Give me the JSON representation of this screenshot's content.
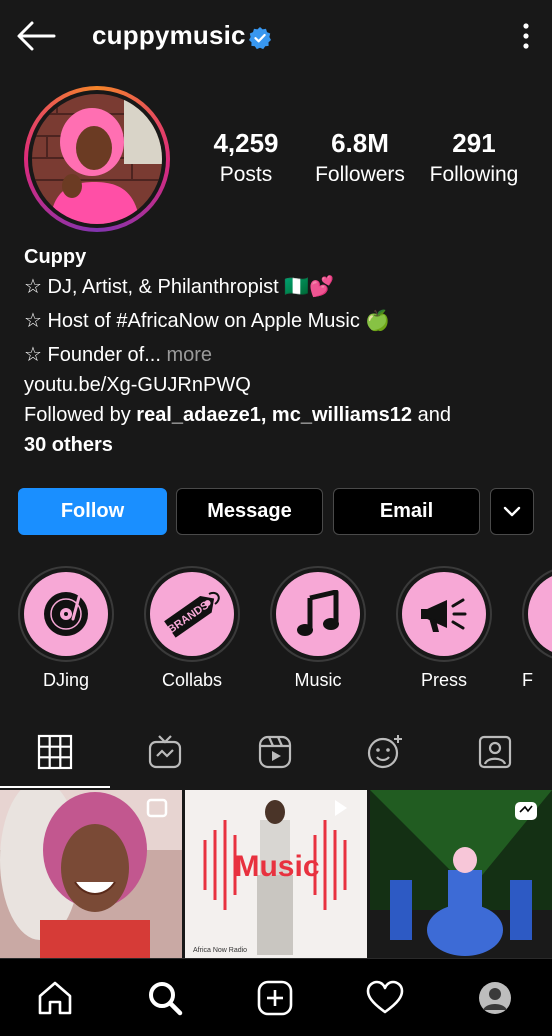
{
  "header": {
    "username": "cuppymusic",
    "verified": true
  },
  "stats": [
    {
      "value": "4,259",
      "label": "Posts"
    },
    {
      "value": "6.8M",
      "label": "Followers"
    },
    {
      "value": "291",
      "label": "Following"
    }
  ],
  "bio": {
    "name": "Cuppy",
    "line1": "☆ DJ, Artist, & Philanthropist 🇳🇬💕",
    "line2": "☆ Host of #AfricaNow on Apple Music 🍏",
    "line3_prefix": "☆ Founder of...",
    "line3_more": " more",
    "link": "youtu.be/Xg-GUJRnPWQ",
    "followed_prefix": "Followed by ",
    "followed_users": "real_adaeze1, mc_williams12",
    "followed_and": " and",
    "followed_others": "30 others"
  },
  "actions": {
    "follow": "Follow",
    "message": "Message",
    "email": "Email"
  },
  "highlights": [
    {
      "label": "DJing",
      "icon": "vinyl-record-icon"
    },
    {
      "label": "Collabs",
      "icon": "brands-tag-icon"
    },
    {
      "label": "Music",
      "icon": "music-note-icon"
    },
    {
      "label": "Press",
      "icon": "megaphone-icon"
    },
    {
      "label": "F",
      "icon": "partial-icon"
    }
  ],
  "brand_tag_text": "BRANDS",
  "grid_post_text": {
    "apple_music": "Music",
    "africa_now": "Africa Now Radio"
  },
  "colors": {
    "background": "#181818",
    "accent": "#1a8fff",
    "highlight_fill": "#f7a8d6",
    "verified": "#3897f0"
  }
}
